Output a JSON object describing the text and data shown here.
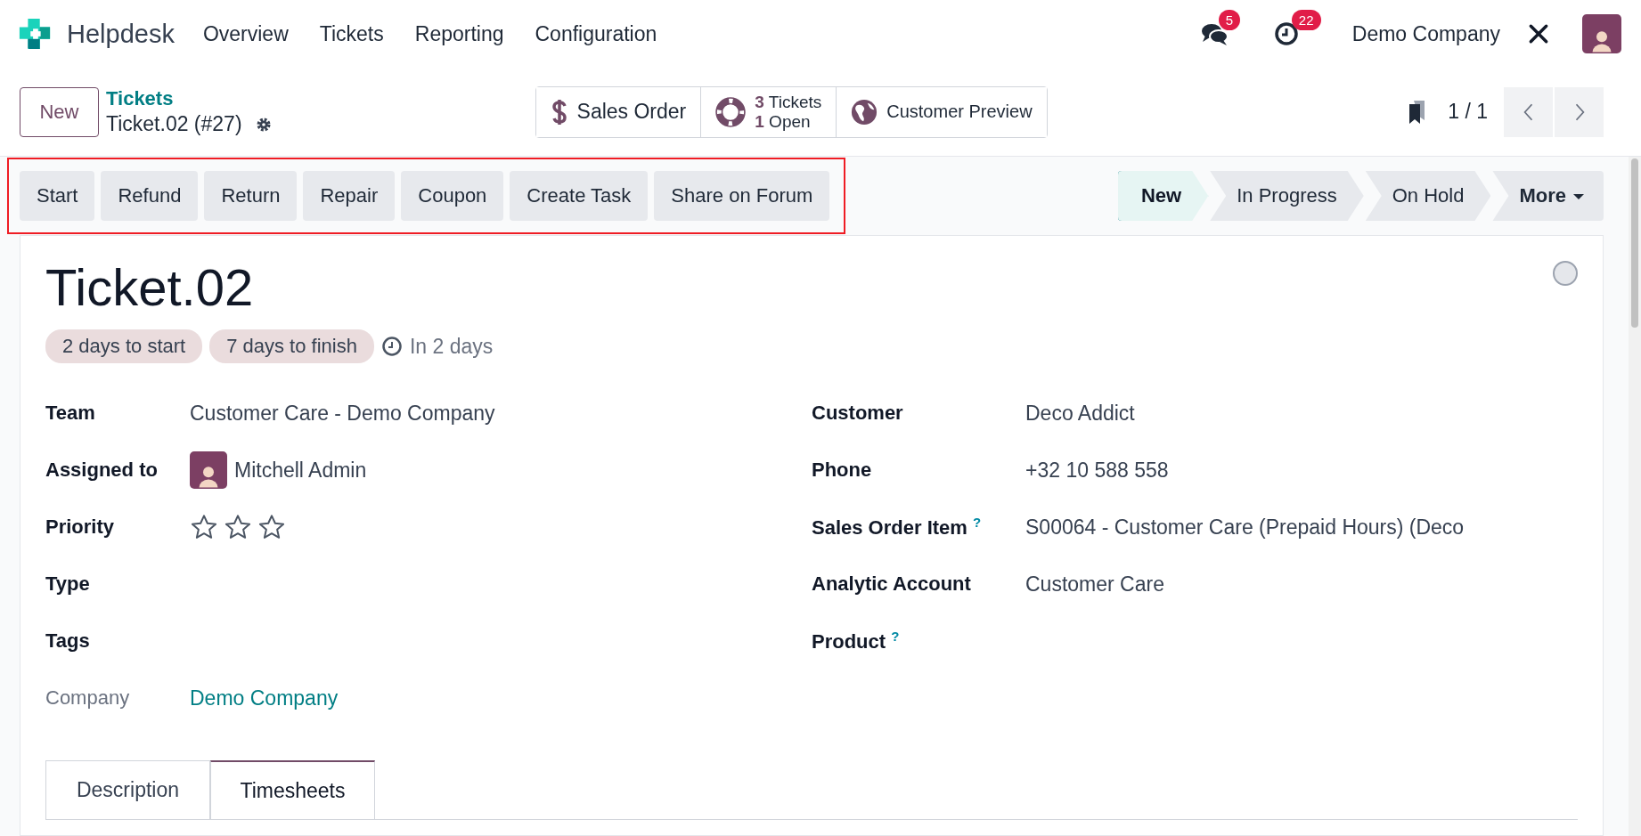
{
  "navbar": {
    "app_name": "Helpdesk",
    "menu": [
      {
        "label": "Overview"
      },
      {
        "label": "Tickets"
      },
      {
        "label": "Reporting"
      },
      {
        "label": "Configuration"
      }
    ],
    "messages_badge": "5",
    "activities_badge": "22",
    "company": "Demo Company"
  },
  "control_panel": {
    "new_button": "New",
    "breadcrumb": "Tickets",
    "record": "Ticket.02 (#27)",
    "smart_buttons": [
      {
        "kind": "plain",
        "label": "Sales Order"
      },
      {
        "kind": "stat",
        "lines": [
          "**3** Tickets",
          "**1** Open"
        ]
      },
      {
        "kind": "plain",
        "label": "Customer Preview"
      }
    ],
    "pager": "1 / 1"
  },
  "action_buttons": [
    "Start",
    "Refund",
    "Return",
    "Repair",
    "Coupon",
    "Create Task",
    "Share on Forum"
  ],
  "stages": [
    {
      "label": "New",
      "selected": true
    },
    {
      "label": "In Progress",
      "selected": false
    },
    {
      "label": "On Hold",
      "selected": false
    }
  ],
  "more_button": "More",
  "ticket": {
    "title": "Ticket.02",
    "badges": [
      "2 days to start",
      "7 days to finish"
    ],
    "deadline": "In 2 days",
    "left_fields": [
      {
        "label": "Team",
        "kind": "text",
        "value": "Customer Care - Demo Company",
        "muted": false
      },
      {
        "label": "Assigned to",
        "kind": "avatar",
        "value": "Mitchell Admin",
        "muted": false
      },
      {
        "label": "Priority",
        "kind": "stars",
        "stars": 0,
        "muted": false
      },
      {
        "label": "Type",
        "kind": "empty",
        "muted": false
      },
      {
        "label": "Tags",
        "kind": "empty",
        "muted": false
      },
      {
        "label": "Company",
        "kind": "link",
        "value": "Demo Company",
        "muted": true
      }
    ],
    "right_fields": [
      {
        "label": "Customer",
        "kind": "text",
        "value": "Deco Addict"
      },
      {
        "label": "Phone",
        "kind": "text",
        "value": "+32 10 588 558"
      },
      {
        "label": "Sales Order Item",
        "help_mark": "?",
        "kind": "text",
        "value": "S00064 - Customer Care (Prepaid Hours) (Deco"
      },
      {
        "label": "Analytic Account",
        "kind": "text",
        "value": "Customer Care"
      },
      {
        "label": "Product",
        "help_mark": "?",
        "kind": "empty"
      }
    ],
    "tabs": [
      {
        "label": "Description",
        "selected": false
      },
      {
        "label": "Timesheets",
        "selected": true
      }
    ]
  }
}
